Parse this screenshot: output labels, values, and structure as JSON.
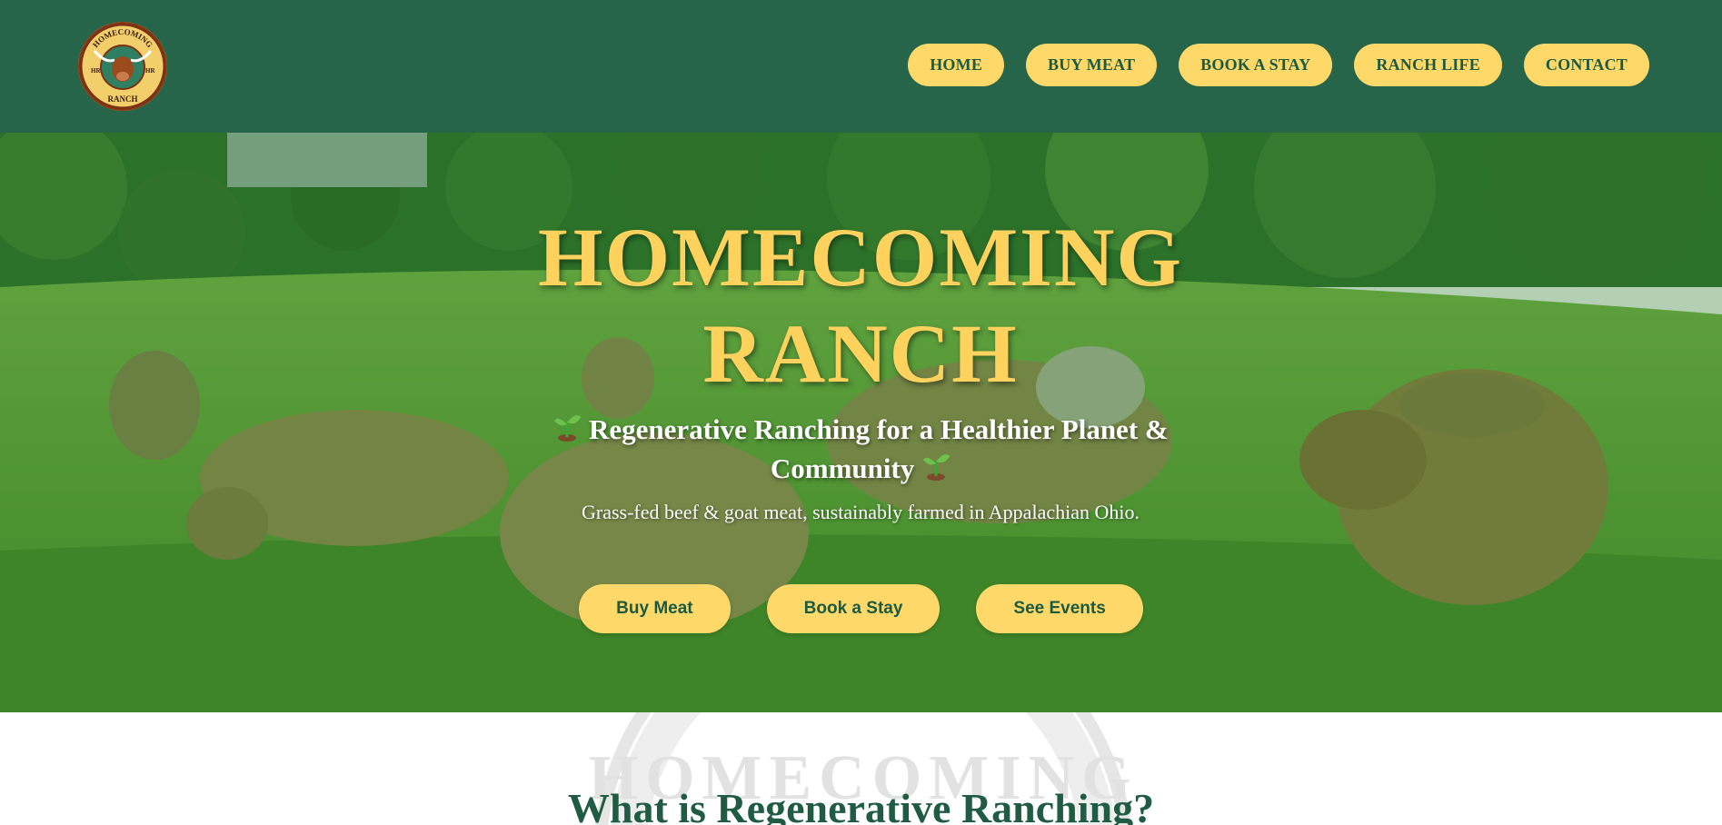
{
  "header": {
    "logo_text_top": "HOMECOMING",
    "logo_text_bottom": "RANCH",
    "logo_brand_left": "HR",
    "logo_brand_right": "HR",
    "nav": [
      {
        "label": "HOME"
      },
      {
        "label": "BUY MEAT"
      },
      {
        "label": "BOOK A STAY"
      },
      {
        "label": "RANCH LIFE"
      },
      {
        "label": "CONTACT"
      }
    ]
  },
  "hero": {
    "title_line1": "HOMECOMING",
    "title_line2": "RANCH",
    "tagline": "Regenerative Ranching for a Healthier Planet & Community",
    "subtext": "Grass-fed beef & goat meat, sustainably farmed in Appalachian Ohio.",
    "buttons": [
      {
        "label": "Buy Meat"
      },
      {
        "label": "Book a Stay"
      },
      {
        "label": "See Events"
      }
    ],
    "icon": "sprout-icon"
  },
  "section": {
    "title": "What is Regenerative Ranching?",
    "watermark_text": "HOMECOMING"
  },
  "colors": {
    "header_green": "#26654a",
    "accent_yellow": "#ffd86a",
    "title_yellow": "#ffd25e",
    "text_green": "#1f5c43"
  }
}
